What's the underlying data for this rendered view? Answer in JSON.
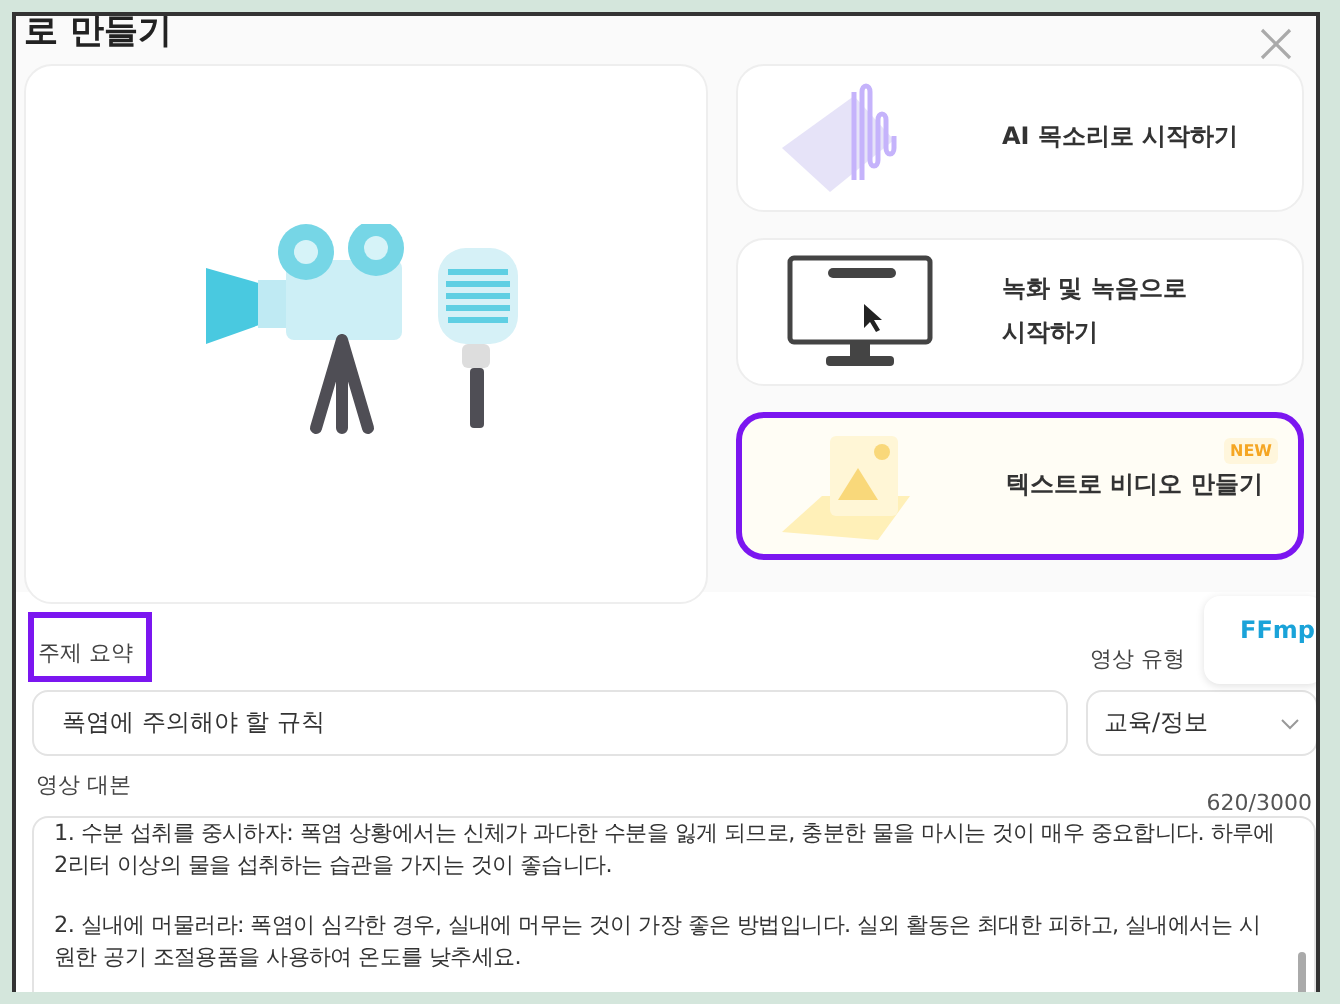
{
  "dialog": {
    "title": "로 만들기"
  },
  "options": [
    {
      "kind": "voice",
      "label": "AI 목소리로 시작하기",
      "highlighted": false
    },
    {
      "kind": "record",
      "label": "녹화 및 녹음으로 시작하기",
      "highlighted": false
    },
    {
      "kind": "text",
      "label": "텍스트로 비디오 만들기",
      "badge": "NEW",
      "highlighted": true
    }
  ],
  "side_card": {
    "label": "FFmp"
  },
  "summary": {
    "label": "주제 요약",
    "highlighted": true,
    "value": "폭염에 주의해야 할 규칙"
  },
  "video_type": {
    "label": "영상 유형",
    "value": "교육/정보"
  },
  "script": {
    "label": "영상 대본",
    "count": "620/3000",
    "paragraphs": [
      "1. 수분 섭취를 중시하자: 폭염 상황에서는 신체가 과다한 수분을 잃게 되므로, 충분한 물을 마시는 것이 매우 중요합니다. 하루에 2리터 이상의 물을 섭취하는 습관을 가지는 것이 좋습니다.",
      "2. 실내에 머물러라: 폭염이 심각한 경우, 실내에 머무는 것이 가장 좋은 방법입니다. 실외 활동은 최대한 피하고, 실내에서는 시원한 공기 조절용품을 사용하여 온도를 낮추세요."
    ]
  }
}
